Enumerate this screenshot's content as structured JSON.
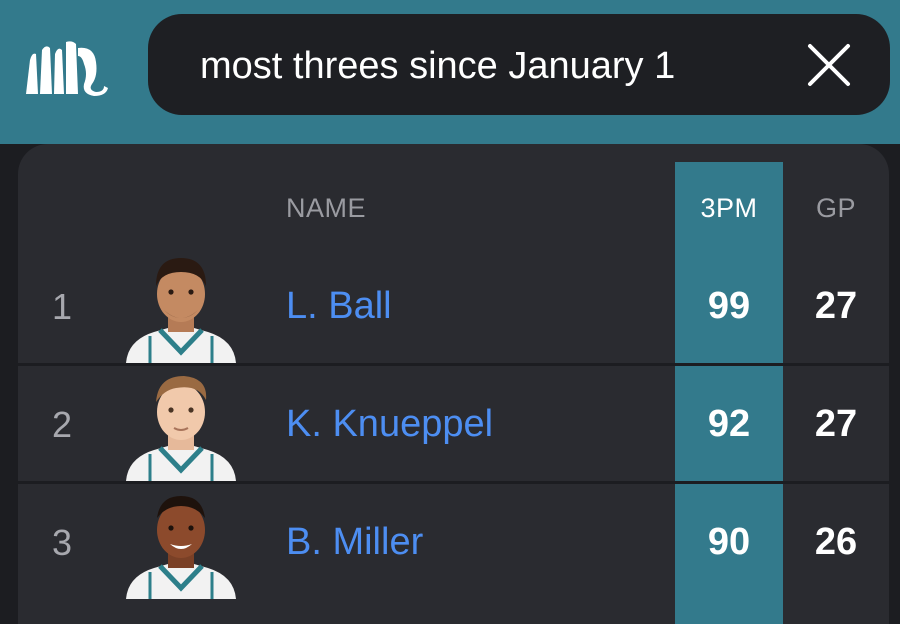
{
  "search": {
    "query": "most threes since January 1"
  },
  "table": {
    "headers": {
      "name": "NAME",
      "three_pm": "3PM",
      "gp": "GP"
    },
    "rows": [
      {
        "rank": "1",
        "name": "L. Ball",
        "three_pm": "99",
        "gp": "27"
      },
      {
        "rank": "2",
        "name": "K. Knueppel",
        "three_pm": "92",
        "gp": "27"
      },
      {
        "rank": "3",
        "name": "B. Miller",
        "three_pm": "90",
        "gp": "26"
      }
    ]
  },
  "colors": {
    "header_bar": "#337a8c",
    "highlight_column": "#337a8c",
    "link": "#4d8ef2",
    "card": "#2a2b30",
    "background": "#1c1d21"
  },
  "icons": {
    "logo": "elephant-logo-icon",
    "clear": "close-icon"
  }
}
